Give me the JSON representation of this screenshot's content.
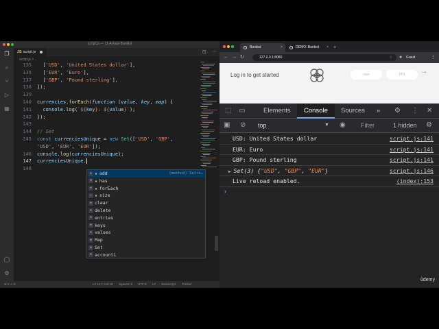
{
  "vscode": {
    "window_title": "script.js — 11-Arrays-Bankist",
    "tab_label": "script.js",
    "tab_badge": "JS",
    "breadcrumb": "script.js > ...",
    "code_lines": [
      {
        "n": "135",
        "html": "  <span class='p'>[</span><span class='s'>'USD'</span><span class='p'>, </span><span class='s'>'United States dollar'</span><span class='p'>],</span>"
      },
      {
        "n": "136",
        "html": "  <span class='p'>[</span><span class='s'>'EUR'</span><span class='p'>, </span><span class='s'>'Euro'</span><span class='p'>],</span>"
      },
      {
        "n": "137",
        "html": "  <span class='p'>[</span><span class='s'>'GBP'</span><span class='p'>, </span><span class='s'>'Pound sterling'</span><span class='p'>],</span>"
      },
      {
        "n": "138",
        "html": "<span class='p'>]);</span>"
      },
      {
        "n": "139",
        "html": ""
      },
      {
        "n": "140",
        "html": "<span class='v'>currencies</span><span class='p'>.</span><span class='f'>forEach</span><span class='p'>(</span><span class='it'>function</span><span class='p'> (</span><span class='it'>value</span><span class='p'>, </span><span class='it'>key</span><span class='p'>, </span><span class='it'>map</span><span class='p'>) {</span>"
      },
      {
        "n": "141",
        "html": "  <span class='v'>console</span><span class='p'>.</span><span class='f'>log</span><span class='p'>(</span><span class='s'>`${</span><span class='v'>key</span><span class='s'>}: ${</span><span class='v'>value</span><span class='s'>}`</span><span class='p'>);</span>"
      },
      {
        "n": "142",
        "html": "<span class='p'>});</span>"
      },
      {
        "n": "143",
        "html": ""
      },
      {
        "n": "144",
        "html": "<span class='c'>// Set</span>"
      },
      {
        "n": "145",
        "html": "<span class='b'>const</span> <span class='v'>currenciesUnique</span><span class='p'> = </span><span class='b'>new</span> <span class='t'>Set</span><span class='p'>([</span><span class='s'>'USD'</span><span class='p'>, </span><span class='s'>'GBP'</span><span class='p'>,</span>"
      },
      {
        "n": "",
        "html": "<span class='s'>'USD'</span><span class='p'>, </span><span class='s'>'EUR'</span><span class='p'>, </span><span class='s'>'EUR'</span><span class='p'>]);</span>"
      },
      {
        "n": "146",
        "html": "<span class='v'>console</span><span class='p'>.</span><span class='f'>log</span><span class='p'>(</span><span class='v'>currenciesUnique</span><span class='p'>);</span>"
      },
      {
        "n": "147",
        "html": "<span class='v'>currenciesUnique</span><span class='p'>.</span><span class='caret'></span>",
        "current": true
      },
      {
        "n": "148",
        "html": ""
      }
    ],
    "suggestions": [
      {
        "label": "add",
        "star": true,
        "detail": "(method) Set<s…",
        "icon": "method"
      },
      {
        "label": "has",
        "star": true,
        "icon": "method"
      },
      {
        "label": "forEach",
        "star": true,
        "icon": "method"
      },
      {
        "label": "size",
        "star": true,
        "icon": "property"
      },
      {
        "label": "clear",
        "icon": "method"
      },
      {
        "label": "delete",
        "icon": "method"
      },
      {
        "label": "entries",
        "icon": "method"
      },
      {
        "label": "keys",
        "icon": "method"
      },
      {
        "label": "values",
        "icon": "method"
      },
      {
        "label": "Map",
        "icon": "class"
      },
      {
        "label": "Set",
        "icon": "class"
      },
      {
        "label": "account1",
        "icon": "variable"
      }
    ],
    "status": {
      "errors": "⊗ 0 ⚠ 0",
      "position": "Ln 147, Col 18",
      "spaces": "Spaces: 2",
      "encoding": "UTF-8",
      "eol": "LF",
      "language": "JavaScript",
      "formatter": "Prettier"
    }
  },
  "browser": {
    "tabs": [
      {
        "label": "Bankist",
        "active": true
      },
      {
        "label": "DEMO: Bankist",
        "active": false
      }
    ],
    "url": "127.0.0.1:8080",
    "profile": "Guest",
    "page": {
      "login_text": "Log in to get started",
      "user_placeholder": "user",
      "pin_placeholder": "PIN",
      "submit_arrow": "→"
    },
    "devtools": {
      "tabs": [
        "Elements",
        "Console",
        "Sources"
      ],
      "active_tab": "Console",
      "more": "»",
      "context": "top",
      "filter_placeholder": "Filter",
      "hidden_count": "1 hidden",
      "logs": [
        {
          "text": "USD: United States dollar",
          "source": "script.js:141"
        },
        {
          "text": "EUR: Euro",
          "source": "script.js:141"
        },
        {
          "text": "GBP: Pound sterling",
          "source": "script.js:141"
        },
        {
          "prefix": "Set(3) {",
          "items": [
            "\"USD\"",
            "\"GBP\"",
            "\"EUR\""
          ],
          "suffix": "}",
          "source": "script.js:146",
          "expandable": true
        },
        {
          "text": "Live reload enabled.",
          "source": "(index):153"
        }
      ],
      "prompt": "›"
    }
  },
  "watermark": "ûdemy",
  "colors": {
    "editor_bg": "#1e1e1e",
    "devtools_bg": "#242424",
    "accent_blue": "#7cacf8",
    "string_orange": "#ce9178"
  }
}
